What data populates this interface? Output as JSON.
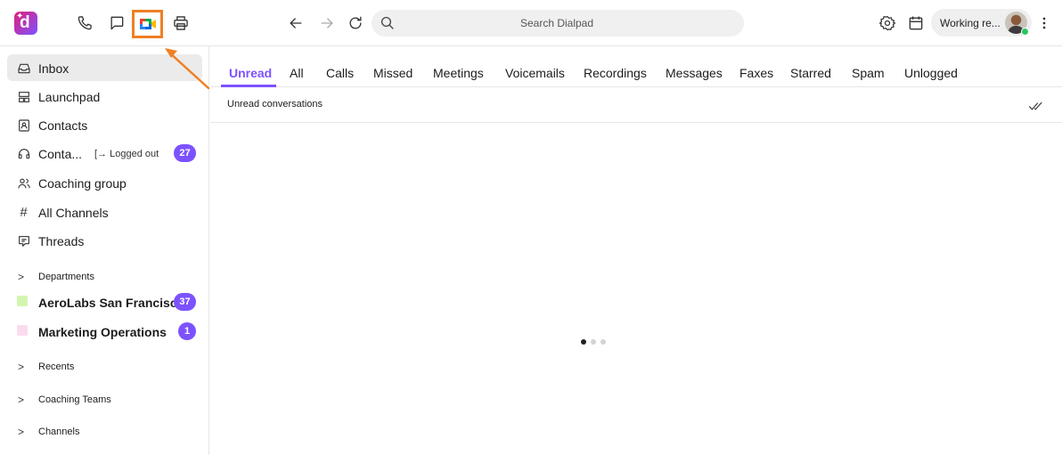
{
  "colors": {
    "accent": "#7c52ff",
    "highlight": "#f07f24",
    "presence": "#29c45e"
  },
  "topbar": {
    "icons": [
      "dialpad-logo",
      "phone-icon",
      "chat-icon",
      "google-meet-icon",
      "print-icon",
      "back-arrow-icon",
      "forward-arrow-icon",
      "reload-icon",
      "search-icon",
      "gear-icon",
      "calendar-icon",
      "more-vertical-icon"
    ],
    "search_placeholder": "Search Dialpad",
    "status_label": "Working re..."
  },
  "sidebar": {
    "items": [
      {
        "label": "Inbox",
        "icon": "inbox-icon",
        "active": true
      },
      {
        "label": "Launchpad",
        "icon": "launchpad-icon"
      },
      {
        "label": "Contacts",
        "icon": "contacts-icon"
      },
      {
        "label": "Conta...",
        "icon": "headset-icon",
        "status": "Logged out",
        "badge": "27"
      },
      {
        "label": "Coaching group",
        "icon": "coaching-group-icon"
      },
      {
        "label": "All Channels",
        "icon": "hash-icon"
      },
      {
        "label": "Threads",
        "icon": "threads-icon"
      }
    ],
    "departments_label": "Departments",
    "departments": [
      {
        "label": "AeroLabs San Francisc...",
        "badge": "37",
        "color": "#d4f5b0"
      },
      {
        "label": "Marketing Operations",
        "badge": "1",
        "color": "#fbdcee"
      }
    ],
    "sections": [
      "Recents",
      "Coaching Teams",
      "Channels"
    ]
  },
  "main": {
    "tabs": [
      "Unread",
      "All",
      "Calls",
      "Missed",
      "Meetings",
      "Voicemails",
      "Recordings",
      "Messages",
      "Faxes",
      "Starred",
      "Spam",
      "Unlogged"
    ],
    "active_tab": "Unread",
    "subheader": "Unread conversations",
    "loader_dots": 3
  }
}
